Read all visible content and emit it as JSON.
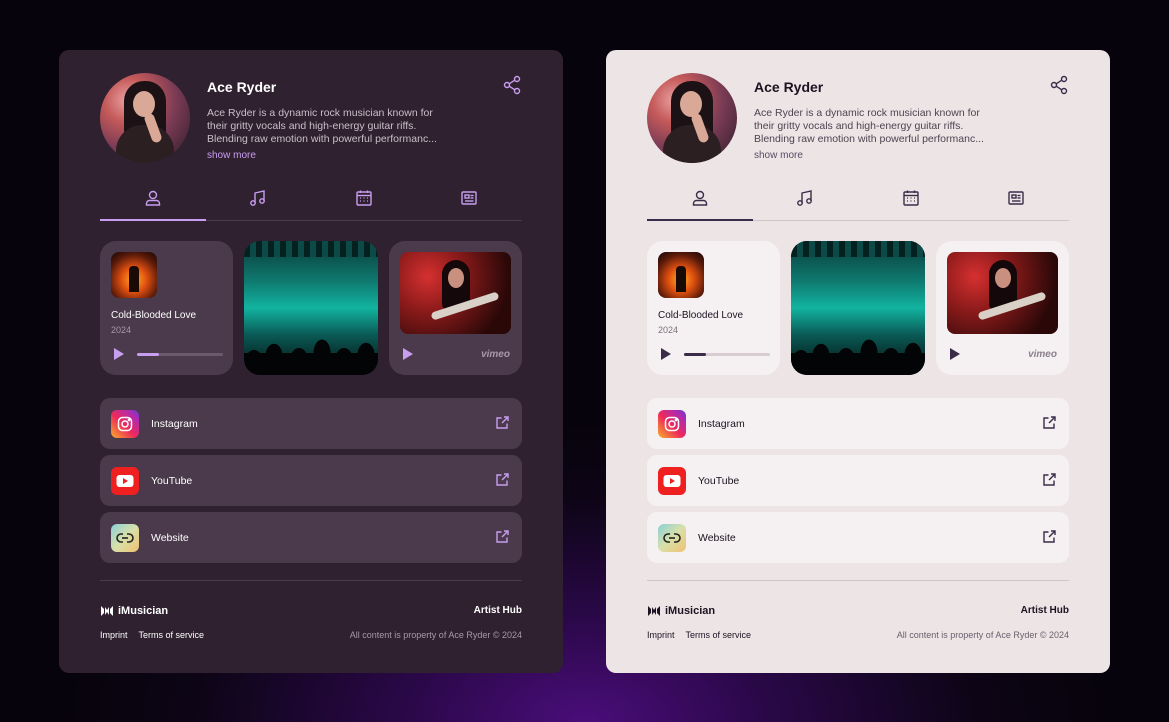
{
  "artist": {
    "name": "Ace Ryder",
    "bio_lines": [
      "Ace Ryder is a dynamic rock musician known for",
      "their gritty vocals and high-energy guitar riffs.",
      "Blending raw emotion with powerful performanc..."
    ],
    "show_more": "show more"
  },
  "tabs": [
    "profile-icon",
    "music-icon",
    "calendar-icon",
    "news-icon"
  ],
  "media": {
    "song": {
      "title": "Cold-Blooded Love",
      "year": "2024",
      "progress": 0.25
    },
    "video": {
      "provider": "vimeo"
    }
  },
  "links": [
    {
      "label": "Instagram",
      "icon": "instagram-icon"
    },
    {
      "label": "YouTube",
      "icon": "youtube-icon"
    },
    {
      "label": "Website",
      "icon": "link-icon"
    }
  ],
  "footer": {
    "brand": "iMusician",
    "hub": "Artist Hub",
    "imprint": "Imprint",
    "terms": "Terms of service",
    "copyright": "All content is property of Ace Ryder  ©  2024"
  },
  "colors": {
    "dark_accent": "#c79ef0",
    "light_accent": "#3a2c48",
    "dark_bg": "#2f2130",
    "light_bg": "#ede4e6"
  }
}
